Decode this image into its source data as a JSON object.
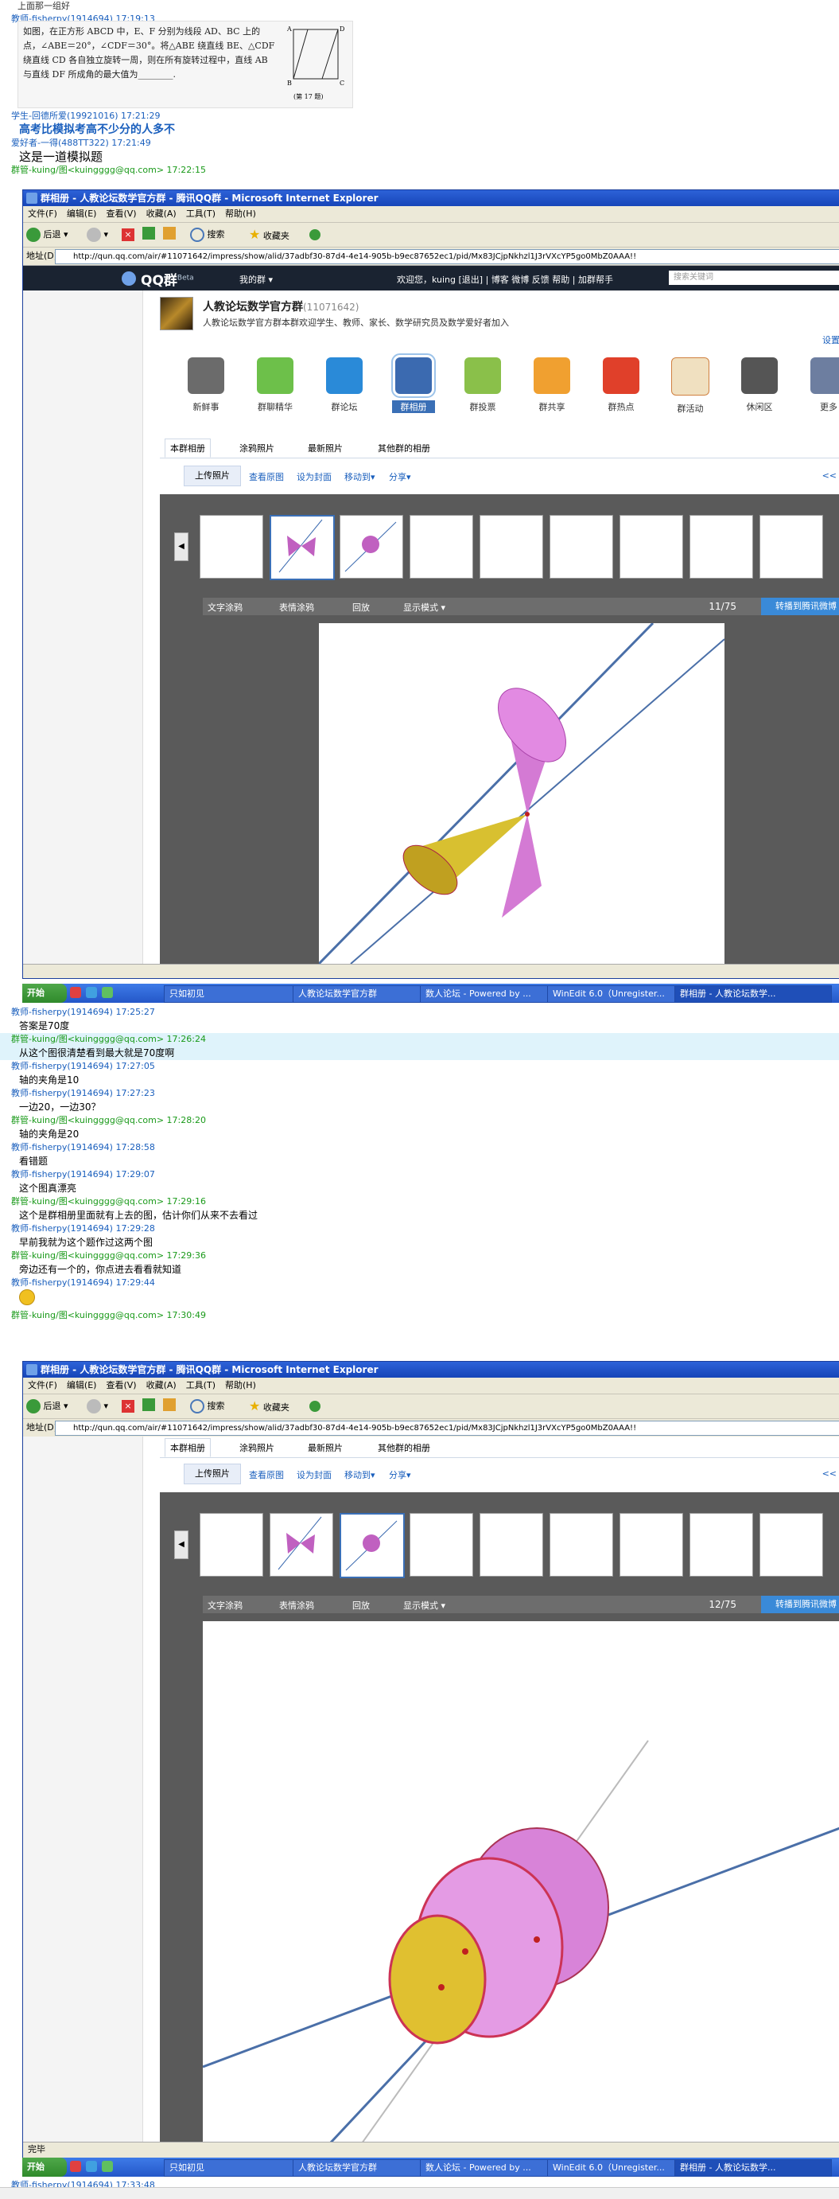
{
  "chat_top": {
    "m1_meta": "上面那一组好",
    "m2_meta": "教师-fisherpy(1914694) 17:19:13",
    "problem_text": "如图，在正方形 ABCD 中，E、F 分别为线段 AD、BC 上的点，∠ABE＝20°，∠CDF＝30°。将△ABE 绕直线 BE、△CDF 绕直线 CD 各自独立旋转一周，则在所有旋转过程中，直线 AB 与直线 DF 所成角的最大值为________.",
    "problem_fig_label": "(第 17 题)",
    "m3_meta": "学生-回德所爱(19921016) 17:21:29",
    "m3_text": "高考比模拟考高不少分的人多不",
    "m4_meta": "爱好者-一得(488TT322) 17:21:49",
    "m4_text": "这是一道模拟题",
    "m5_meta": "群管-kuing/图<kuingggg@qq.com> 17:22:15"
  },
  "window1": {
    "title": "群相册 - 人教论坛数学官方群 - 腾讯QQ群 - Microsoft Internet Explorer",
    "menu": [
      "文件(F)",
      "编辑(E)",
      "查看(V)",
      "收藏(A)",
      "工具(T)",
      "帮助(H)"
    ],
    "back": "后退",
    "search": "搜索",
    "favorites": "收藏夹",
    "addr_label": "地址(D)",
    "url": "http://qun.qq.com/air/#11071642/impress/show/alid/37adbf30-87d4-4e14-905b-b9ec87652ec1/pid/Mx83JCjpNkhzl1J3rVXcYP5go0MbZ0AAA!!",
    "qq_logo": "QQ群",
    "qq_beta": "Beta",
    "my_group": "我的群 ▾",
    "welcome": "欢迎您，kuing [退出] | 博客 微博 反馈 帮助 | 加群帮手",
    "search_placeholder": "搜索关键词",
    "group_name": "人教论坛数学官方群",
    "group_id": "(11071642)",
    "group_desc": "人教论坛数学官方群本群欢迎学生、教师、家长、数学研究员及数学爱好者加入",
    "settings": "设置",
    "nav": [
      "新鲜事",
      "群聊精华",
      "群论坛",
      "群相册",
      "群投票",
      "群共享",
      "群热点",
      "群活动",
      "休闲区",
      "更多"
    ],
    "tabs": [
      "本群相册",
      "涂鸦照片",
      "最新照片",
      "其他群的相册"
    ],
    "actions": [
      "上传照片",
      "查看原图",
      "设为封面",
      "移动到▾",
      "分享▾"
    ],
    "viewer_tools": [
      "文字涂鸦",
      "表情涂鸦",
      "回放",
      "显示模式 ▾"
    ],
    "counter": "11/75",
    "weibo": "转播到腾讯微博",
    "prev_next": "<<"
  },
  "taskbar1": {
    "start": "开始",
    "items": [
      "只如初见",
      "人教论坛数学官方群",
      "数人论坛 - Powered by ...",
      "WinEdit 6.0（Unregister...",
      "群相册 - 人教论坛数学..."
    ]
  },
  "chat_mid": [
    {
      "meta": "教师-fisherpy(1914694) 17:25:27",
      "text": "答案是70度",
      "hl": false,
      "meta_color": "blue"
    },
    {
      "meta": "群管-kuing/图<kuingggg@qq.com> 17:26:24",
      "text": "从这个图很清楚看到最大就是70度啊",
      "hl": true,
      "meta_color": "green"
    },
    {
      "meta": "教师-fisherpy(1914694) 17:27:05",
      "text": "轴的夹角是10",
      "hl": false,
      "meta_color": "blue"
    },
    {
      "meta": "教师-fisherpy(1914694) 17:27:23",
      "text": "一边20，一边30？",
      "hl": false,
      "meta_color": "blue"
    },
    {
      "meta": "群管-kuing/图<kuingggg@qq.com> 17:28:20",
      "text": "轴的夹角是20",
      "hl": false,
      "meta_color": "green"
    },
    {
      "meta": "教师-fisherpy(1914694) 17:28:58",
      "text": "看错题",
      "hl": false,
      "meta_color": "blue"
    },
    {
      "meta": "教师-fisherpy(1914694) 17:29:07",
      "text": "这个图真漂亮",
      "hl": false,
      "meta_color": "blue"
    },
    {
      "meta": "群管-kuing/图<kuingggg@qq.com> 17:29:16",
      "text": "这个是群相册里面就有上去的图，估计你们从来不去看过",
      "hl": false,
      "meta_color": "green"
    },
    {
      "meta": "教师-fisherpy(1914694) 17:29:28",
      "text": "早前我就为这个题作过这两个图",
      "hl": false,
      "meta_color": "blue"
    },
    {
      "meta": "群管-kuing/图<kuingggg@qq.com> 17:29:36",
      "text": "旁边还有一个的，你点进去看看就知道",
      "hl": false,
      "meta_color": "green"
    },
    {
      "meta": "教师-fisherpy(1914694) 17:29:44",
      "text": "",
      "hl": false,
      "meta_color": "blue"
    },
    {
      "meta": "群管-kuing/图<kuingggg@qq.com> 17:30:49",
      "text": "",
      "hl": false,
      "meta_color": "green"
    }
  ],
  "window2": {
    "counter": "12/75",
    "status": "完毕"
  },
  "chat_bottom": {
    "meta": "教师-fisherpy(1914694) 17:33:48"
  }
}
